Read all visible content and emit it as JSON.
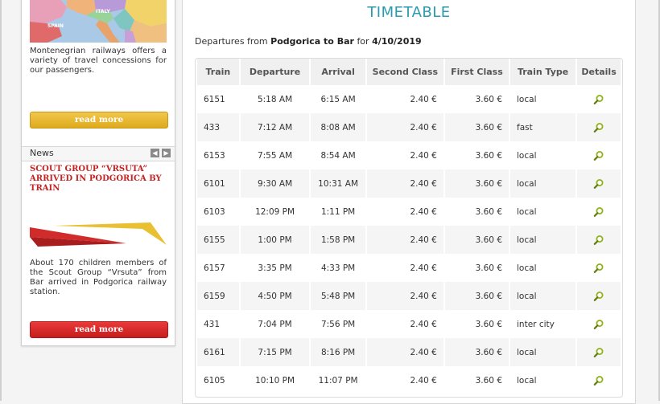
{
  "sidebar": {
    "promo_text": "Montenegrian railways offers a variety of travel concessions for our passengers.",
    "map_labels": [
      "ITALY",
      "SPAIN"
    ],
    "read_more_1": "read more",
    "news_label": "News",
    "news_prev": "◀",
    "news_next": "▶",
    "news_title": "SCOUT GROUP “VRSUTA” ARRIVED IN PODGORICA BY TRAIN",
    "news_text": "About 170 children members of the Scout Group “Vrsuta” from Bar arrived in Podgorica railway station.",
    "read_more_2": "read more"
  },
  "main": {
    "title": "TIMETABLE",
    "subtitle_prefix": "Departures from",
    "route": "Podgorica to Bar",
    "subtitle_for": "for",
    "date": "4/10/2019"
  },
  "table": {
    "headers": [
      "Train",
      "Departure",
      "Arrival",
      "Second Class",
      "First Class",
      "Train Type",
      "Details"
    ],
    "rows": [
      {
        "train": "6151",
        "departure": "5:18 AM",
        "arrival": "6:15 AM",
        "second": "2.40 €",
        "first": "3.60 €",
        "type": "local"
      },
      {
        "train": "433",
        "departure": "7:12 AM",
        "arrival": "8:08 AM",
        "second": "2.40 €",
        "first": "3.60 €",
        "type": "fast"
      },
      {
        "train": "6153",
        "departure": "7:55 AM",
        "arrival": "8:54 AM",
        "second": "2.40 €",
        "first": "3.60 €",
        "type": "local"
      },
      {
        "train": "6101",
        "departure": "9:30 AM",
        "arrival": "10:31 AM",
        "second": "2.40 €",
        "first": "3.60 €",
        "type": "local"
      },
      {
        "train": "6103",
        "departure": "12:09 PM",
        "arrival": "1:11 PM",
        "second": "2.40 €",
        "first": "3.60 €",
        "type": "local"
      },
      {
        "train": "6155",
        "departure": "1:00 PM",
        "arrival": "1:58 PM",
        "second": "2.40 €",
        "first": "3.60 €",
        "type": "local"
      },
      {
        "train": "6157",
        "departure": "3:35 PM",
        "arrival": "4:33 PM",
        "second": "2.40 €",
        "first": "3.60 €",
        "type": "local"
      },
      {
        "train": "6159",
        "departure": "4:50 PM",
        "arrival": "5:48 PM",
        "second": "2.40 €",
        "first": "3.60 €",
        "type": "local"
      },
      {
        "train": "431",
        "departure": "7:04 PM",
        "arrival": "7:56 PM",
        "second": "2.40 €",
        "first": "3.60 €",
        "type": "inter city"
      },
      {
        "train": "6161",
        "departure": "7:15 PM",
        "arrival": "8:16 PM",
        "second": "2.40 €",
        "first": "3.60 €",
        "type": "local"
      },
      {
        "train": "6105",
        "departure": "10:10 PM",
        "arrival": "11:07 PM",
        "second": "2.40 €",
        "first": "3.60 €",
        "type": "local"
      }
    ]
  },
  "colors": {
    "title": "#2b9ab0",
    "news_title": "#c52424",
    "button_yellow": "#ddaa1d",
    "button_red": "#c51d1d",
    "details_icon": "#8fb21a"
  },
  "icons": {
    "details": "magnifier-icon",
    "prev": "arrow-left-icon",
    "next": "arrow-right-icon"
  }
}
